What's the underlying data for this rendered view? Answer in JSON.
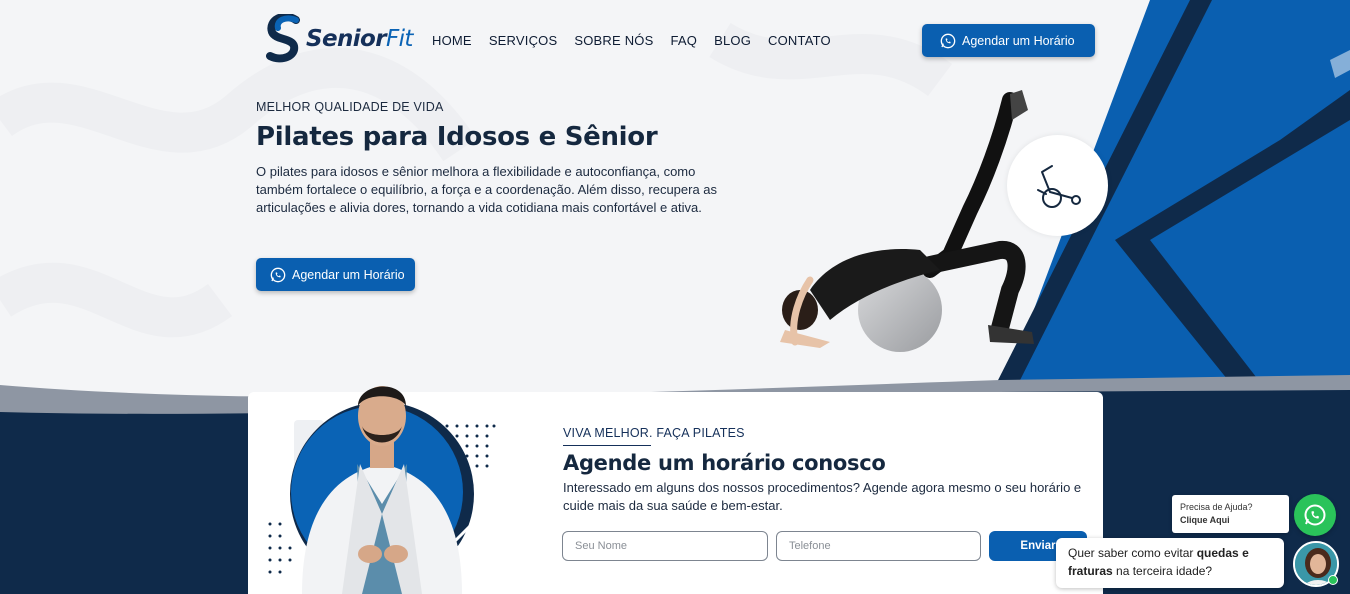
{
  "brand": {
    "name_primary": "Senior",
    "name_secondary": "Fit"
  },
  "nav": {
    "items": [
      "HOME",
      "SERVIÇOS",
      "SOBRE NÓS",
      "FAQ",
      "BLOG",
      "CONTATO"
    ]
  },
  "header": {
    "cta_label": "Agendar um Horário"
  },
  "hero": {
    "kicker": "MELHOR QUALIDADE DE VIDA",
    "title": "Pilates para Idosos e Sênior",
    "description": "O pilates para idosos e sênior melhora a flexibilidade e autoconfiança, como também fortalece o equilíbrio, a força e a coordenação. Além disso, recupera as articulações e alivia dores, tornando a vida cotidiana mais confortável e ativa.",
    "cta_label": "Agendar um Horário"
  },
  "booking": {
    "kicker": "VIVA MELHOR. FAÇA PILATES",
    "title": "Agende um horário conosco",
    "description": "Interessado em alguns dos nossos procedimentos? Agende agora mesmo o seu horário e cuide mais da sua saúde e bem-estar.",
    "name_placeholder": "Seu Nome",
    "phone_placeholder": "Telefone",
    "submit_label": "Enviar"
  },
  "chat": {
    "help_text": "Precisa de Ajuda? ",
    "help_link": "Clique Aqui",
    "message_prefix": "Quer saber como evitar ",
    "message_bold": "quedas e fraturas",
    "message_suffix": " na terceira idade?"
  },
  "colors": {
    "brand_blue": "#0a5fb0",
    "navy": "#0f2a4a",
    "whatsapp_green": "#2ac35a"
  }
}
